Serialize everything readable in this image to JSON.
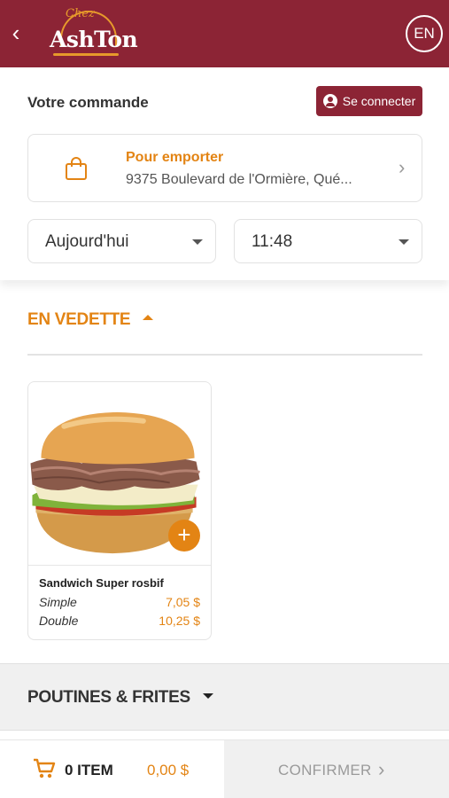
{
  "header": {
    "back_icon": "chevron-left-icon",
    "back_glyph": "‹",
    "logo_script": "Chez",
    "logo_name": "AshTon",
    "language_button": "EN",
    "colors": {
      "bar": "#8c2435",
      "accent": "#e38414"
    }
  },
  "order": {
    "title": "Votre commande",
    "connect_button": "Se connecter",
    "pickup": {
      "label": "Pour emporter",
      "address": "9375 Boulevard de l'Ormière, Qué...",
      "chevron": "›"
    },
    "day_select": "Aujourd'hui",
    "time_select": "11:48"
  },
  "featured": {
    "heading": "EN VEDETTE",
    "product": {
      "name": "Sandwich Super rosbif",
      "add_glyph": "+",
      "options": [
        {
          "label": "Simple",
          "price": "7,05 $"
        },
        {
          "label": "Double",
          "price": "10,25 $"
        }
      ]
    }
  },
  "category": {
    "heading": "POUTINES & FRITES"
  },
  "cart": {
    "count": "0 ITEM",
    "total": "0,00 $",
    "confirm": "CONFIRMER",
    "confirm_chevron": "›"
  }
}
